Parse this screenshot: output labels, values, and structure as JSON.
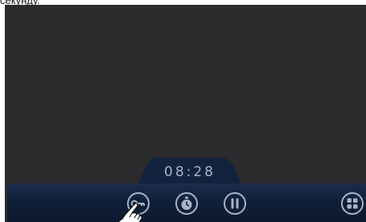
{
  "caption": {
    "text": "секунду."
  },
  "timer": {
    "value": "08:28"
  },
  "controls": {
    "lock_icon": "key-lock-icon",
    "timer_icon": "stopwatch-icon",
    "pause_icon": "pause-icon",
    "menu_icon": "grid-menu-icon"
  },
  "theme": {
    "screen_bg": "#2b2b2d",
    "bar_bg": "#112039",
    "icon_color": "#a6b4c8"
  }
}
